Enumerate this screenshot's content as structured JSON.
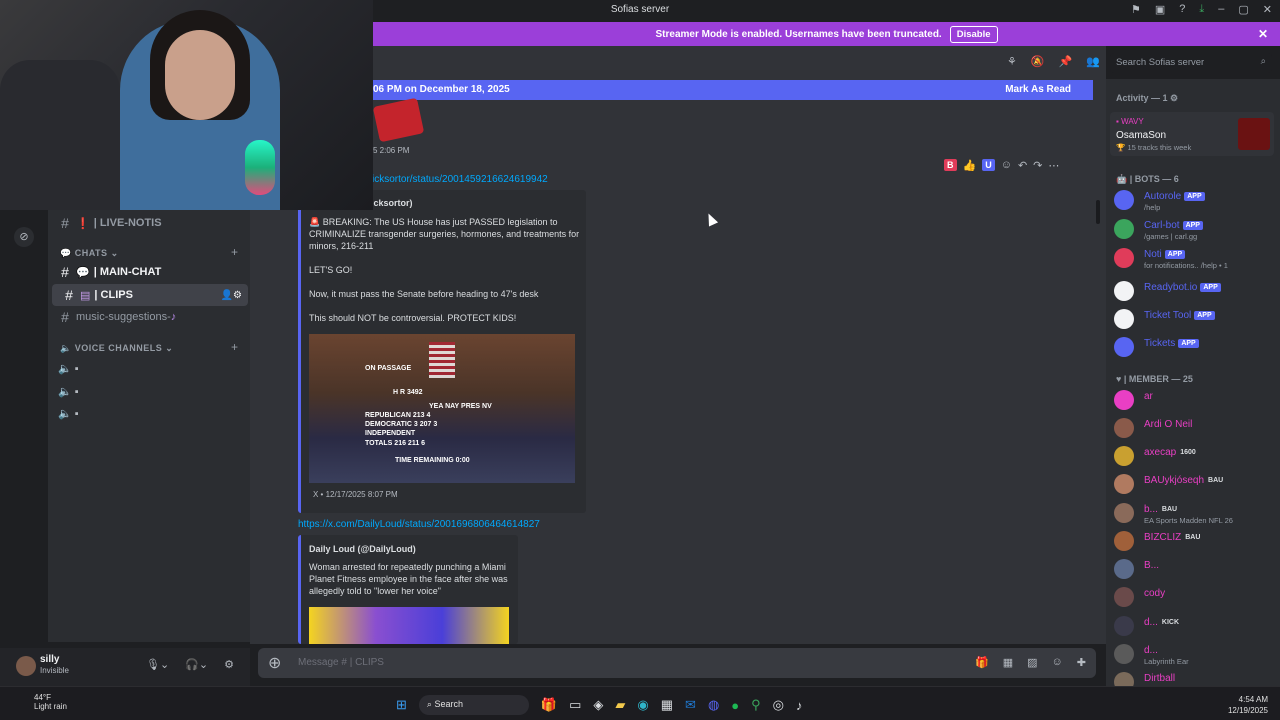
{
  "window": {
    "title": "Sofias server"
  },
  "banner": {
    "text": "Streamer Mode is enabled. Usernames have been truncated.",
    "disable_label": "Disable"
  },
  "search": {
    "placeholder": "Search Sofias server"
  },
  "channels": {
    "live_notis": "| LIVE-NOTIS",
    "chats_category": "CHATS",
    "main_chat": "| MAIN-CHAT",
    "clips": "| CLIPS",
    "music_suggestions": "music-suggestions-",
    "voice_category": "VOICE CHANNELS"
  },
  "chat": {
    "new_messages": "06 PM on December 18, 2025",
    "mark_as_read": "Mark As Read",
    "small_timestamp": "5 2:06 PM",
    "link1": "icksortor/status/2001459216624619942",
    "embed1": {
      "author": "icksortor)",
      "line1": "BREAKING: The US House has just PASSED legislation to",
      "line2": "CRIMINALIZE transgender surgeries, hormones, and treatments for",
      "line3": "minors, 216-211",
      "line4": "LET'S GO!",
      "line5": "Now, it must pass the Senate before heading to 47's desk",
      "line6": "This should NOT be controversial. PROTECT KIDS!",
      "footer": "X • 12/17/2025 8:07 PM",
      "image_text": {
        "t1": "ON PASSAGE",
        "t2": "H R 3492",
        "t3": "YEA NAY PRES NV",
        "t4": "REPUBLICAN 213 4",
        "t5": "DEMOCRATIC 3 207 3",
        "t6": "INDEPENDENT",
        "t7": "TOTALS 216 211 6",
        "t8": "TIME REMAINING 0:00"
      }
    },
    "link2": "https://x.com/DailyLoud/status/2001696806464614827",
    "embed2": {
      "author": "Daily Loud (@DailyLoud)",
      "line1": "Woman arrested for repeatedly punching a Miami",
      "line2": "Planet Fitness employee in the face after she was",
      "line3": "allegedly told to \"lower her voice\""
    }
  },
  "composer": {
    "placeholder": "Message #  | CLIPS"
  },
  "user": {
    "name": "silly",
    "status": "Invisible"
  },
  "members": {
    "activity_header": "Activity — 1",
    "activity_tag": "WAVY",
    "activity_user": "OsamaSon",
    "activity_sub": "15 tracks this week",
    "bots_header": "| BOTS — 6",
    "member_header": "| MEMBER — 25",
    "app_label": "APP",
    "bots": [
      {
        "name": "Autorole",
        "sub": "/help",
        "color": "#5865f2"
      },
      {
        "name": "Carl-bot",
        "sub": "/games | carl.gg",
        "color": "#5865f2"
      },
      {
        "name": "Noti",
        "sub": "for notifications.. /help • 1",
        "color": "#5865f2"
      },
      {
        "name": "Readybot.io",
        "sub": "",
        "color": "#5865f2"
      },
      {
        "name": "Ticket Tool",
        "sub": "",
        "color": "#5865f2"
      },
      {
        "name": "Tickets",
        "sub": "",
        "color": "#5865f2"
      }
    ],
    "people": [
      {
        "name": "ar",
        "sub": "",
        "badge": ""
      },
      {
        "name": "Ardi O Neil",
        "sub": "",
        "badge": ""
      },
      {
        "name": "axecap",
        "sub": "",
        "badge": "1600"
      },
      {
        "name": "BAUykjóseqh",
        "sub": "",
        "badge": "BAU"
      },
      {
        "name": "b...",
        "sub": "EA Sports Madden NFL 26",
        "badge": "BAU"
      },
      {
        "name": "BIZCLIZ",
        "sub": "",
        "badge": "BAU"
      },
      {
        "name": "B...",
        "sub": "",
        "badge": ""
      },
      {
        "name": "cody",
        "sub": "",
        "badge": ""
      },
      {
        "name": "d...",
        "sub": "",
        "badge": "KICK"
      },
      {
        "name": "d...",
        "sub": "Labyrinth Ear",
        "badge": ""
      },
      {
        "name": "Dirtball",
        "sub": "",
        "badge": ""
      }
    ]
  },
  "taskbar": {
    "temp": "44°F",
    "weather": "Light rain",
    "search": "Search",
    "time": "4:54 AM",
    "date": "12/19/2025"
  },
  "colors": {
    "accent": "#5865f2",
    "member_name": "#e93fc4",
    "banner": "#9b3fd9"
  }
}
